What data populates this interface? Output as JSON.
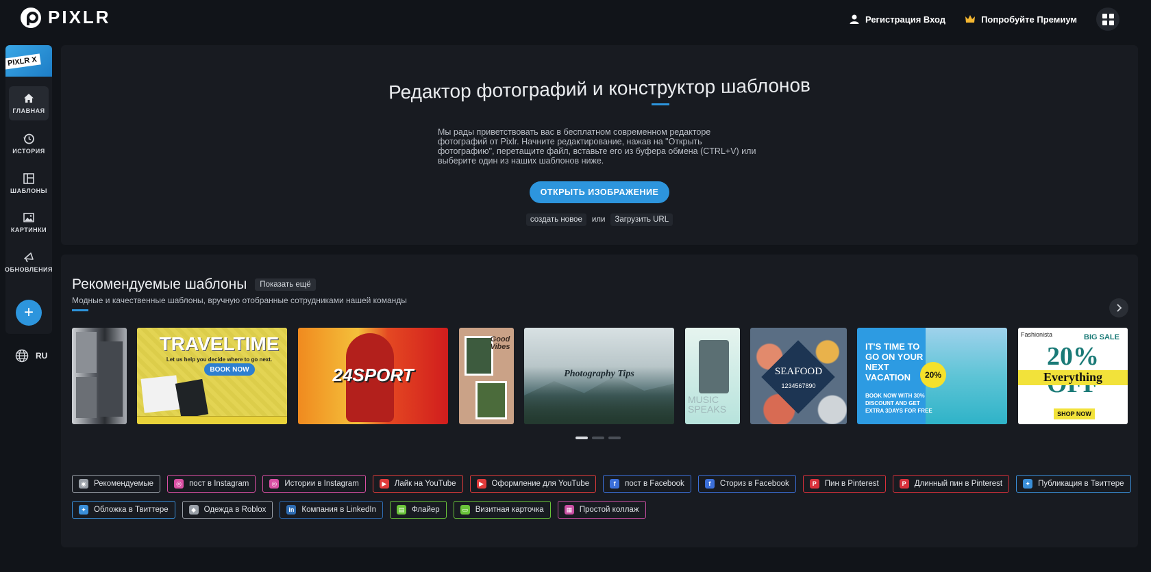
{
  "header": {
    "logo_text": "PIXLR",
    "auth_label": "Регистрация Вход",
    "premium_label": "Попробуйте Премиум"
  },
  "sidebar": {
    "promo_label": "PIXLR X",
    "items": [
      {
        "label": "ГЛАВНАЯ",
        "icon": "home-icon",
        "active": true
      },
      {
        "label": "ИСТОРИЯ",
        "icon": "history-icon"
      },
      {
        "label": "ШАБЛОНЫ",
        "icon": "templates-icon"
      },
      {
        "label": "КАРТИНКИ",
        "icon": "image-icon"
      },
      {
        "label": "ОБНОВЛЕНИЯ",
        "icon": "megaphone-icon"
      }
    ],
    "add_label": "+",
    "language": "RU"
  },
  "hero": {
    "title": "Редактор фотографий и конструктор шаблонов",
    "description": "Мы рады приветствовать вас в бесплатном современном редакторе фотографий от Pixlr. Начните редактирование, нажав на \"Открыть фотографию\", перетащите файл, вставьте его из буфера обмена (CTRL+V) или выберите один из наших шаблонов ниже.",
    "open_button": "ОТКРЫТЬ ИЗОБРАЖЕНИЕ",
    "create_new": "создать новое",
    "or": "или",
    "load_url": "Загрузить URL"
  },
  "templates": {
    "title": "Рекомендуемые шаблоны",
    "show_more": "Показать ещё",
    "subtitle": "Модные и качественные шаблоны, вручную отобранные сотрудниками нашей команды",
    "cards": [
      {
        "name": "collage",
        "text": ""
      },
      {
        "name": "traveltime",
        "text": "TRAVELTIME",
        "sub": "Let us help you decide where to go next.",
        "cta": "BOOK NOW"
      },
      {
        "name": "sport",
        "text": "24SPORT"
      },
      {
        "name": "good-vibes",
        "text": "Good Vibes"
      },
      {
        "name": "photography-tips",
        "text": "Photography Tips"
      },
      {
        "name": "music-speaks",
        "text": "MUSIC SPEAKS"
      },
      {
        "name": "seafood",
        "text": "SEAFOOD",
        "sub": "1234567890"
      },
      {
        "name": "vacation",
        "text": "IT'S TIME TO GO ON YOUR NEXT VACATION",
        "badge": "20%",
        "sub": "BOOK NOW WITH 30% DISCOUNT AND GET EXTRA 3DAYS FOR FREE"
      },
      {
        "name": "big-sale",
        "text": "20% OFF",
        "sub": "Everything",
        "cta": "SHOP NOW",
        "brand": "Fashionista",
        "tag": "BIG SALE"
      }
    ],
    "pager_count": 3,
    "tags_row1": [
      {
        "label": "Рекомендуемые",
        "color": "#9aa0a8",
        "icon": "eye-icon"
      },
      {
        "label": "пост в Instagram",
        "color": "#d94fa3",
        "icon": "instagram-icon"
      },
      {
        "label": "Истории в Instagram",
        "color": "#d94fa3",
        "icon": "instagram-icon"
      },
      {
        "label": "Лайк на YouTube",
        "color": "#e03b3b",
        "icon": "youtube-icon"
      },
      {
        "label": "Оформление для YouTube",
        "color": "#e03b3b",
        "icon": "youtube-icon"
      },
      {
        "label": "пост в Facebook",
        "color": "#3b6fd9",
        "icon": "facebook-icon"
      },
      {
        "label": "Сториз в Facebook",
        "color": "#3b6fd9",
        "icon": "facebook-icon"
      },
      {
        "label": "Пин в Pinterest",
        "color": "#d9303b",
        "icon": "pinterest-icon"
      },
      {
        "label": "Длинный пин в Pinterest",
        "color": "#d9303b",
        "icon": "pinterest-icon"
      },
      {
        "label": "Публикация в Твиттере",
        "color": "#3a8fd9",
        "icon": "twitter-icon"
      }
    ],
    "tags_row2": [
      {
        "label": "Обложка в Твиттере",
        "color": "#3a8fd9",
        "icon": "twitter-icon"
      },
      {
        "label": "Одежда в Roblox",
        "color": "#9aa0a8",
        "icon": "roblox-icon"
      },
      {
        "label": "Компания в LinkedIn",
        "color": "#2f6db3",
        "icon": "linkedin-icon"
      },
      {
        "label": "Флайер",
        "color": "#6ac43a",
        "icon": "flyer-icon"
      },
      {
        "label": "Визитная карточка",
        "color": "#6ac43a",
        "icon": "business-card-icon"
      },
      {
        "label": "Простой коллаж",
        "color": "#c94fa3",
        "icon": "collage-icon"
      }
    ]
  }
}
